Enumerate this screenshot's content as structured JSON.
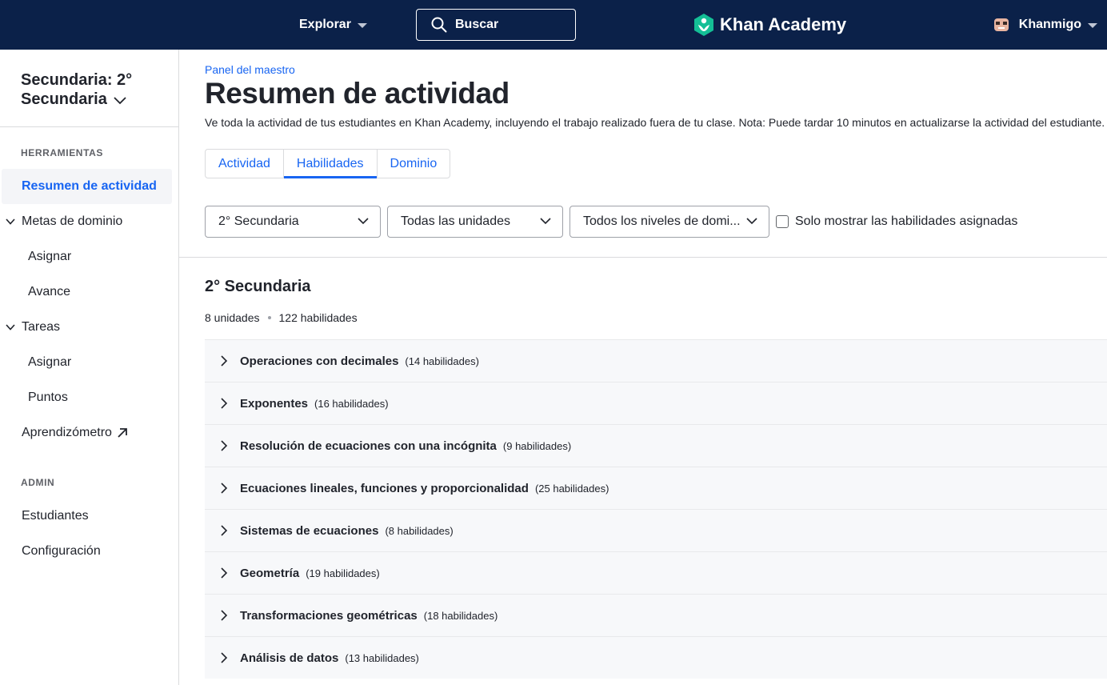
{
  "topnav": {
    "explore_label": "Explorar",
    "search_label": "Buscar",
    "logo_text": "Khan Academy",
    "user_label": "Khanmigo"
  },
  "sidebar": {
    "class_name": "Secundaria: 2° Secundaria",
    "tools_heading": "HERRAMIENTAS",
    "items": [
      {
        "label": "Resumen de actividad"
      },
      {
        "label": "Metas de dominio"
      },
      {
        "label": "Asignar"
      },
      {
        "label": "Avance"
      },
      {
        "label": "Tareas"
      },
      {
        "label": "Asignar"
      },
      {
        "label": "Puntos"
      },
      {
        "label": "Aprendizómetro"
      }
    ],
    "admin_heading": "ADMIN",
    "admin_items": [
      {
        "label": "Estudiantes"
      },
      {
        "label": "Configuración"
      }
    ]
  },
  "main": {
    "breadcrumb": "Panel del maestro",
    "title": "Resumen de actividad",
    "description": "Ve toda la actividad de tus estudiantes en Khan Academy, incluyendo el trabajo realizado fuera de tu clase. Nota: Puede tardar 10 minutos en actualizarse la actividad del estudiante.",
    "tabs": [
      {
        "label": "Actividad"
      },
      {
        "label": "Habilidades"
      },
      {
        "label": "Dominio"
      }
    ],
    "filters": {
      "grade": "2° Secundaria",
      "units": "Todas las unidades",
      "levels": "Todos los niveles de domi...",
      "assigned_only_label": "Solo mostrar las habilidades asignadas"
    },
    "grade_section": {
      "title": "2° Secundaria",
      "units_count": "8 unidades",
      "skills_count": "122 habilidades"
    },
    "units": [
      {
        "name": "Operaciones con decimales",
        "count": "(14 habilidades)"
      },
      {
        "name": "Exponentes",
        "count": "(16 habilidades)"
      },
      {
        "name": "Resolución de ecuaciones con una incógnita",
        "count": "(9 habilidades)"
      },
      {
        "name": "Ecuaciones lineales, funciones y proporcionalidad",
        "count": "(25 habilidades)"
      },
      {
        "name": "Sistemas de ecuaciones",
        "count": "(8 habilidades)"
      },
      {
        "name": "Geometría",
        "count": "(19 habilidades)"
      },
      {
        "name": "Transformaciones geométricas",
        "count": "(18 habilidades)"
      },
      {
        "name": "Análisis de datos",
        "count": "(13 habilidades)"
      }
    ]
  },
  "colors": {
    "nav_bg": "#0b2149",
    "accent": "#1865f2",
    "logo_green": "#14bf96"
  }
}
